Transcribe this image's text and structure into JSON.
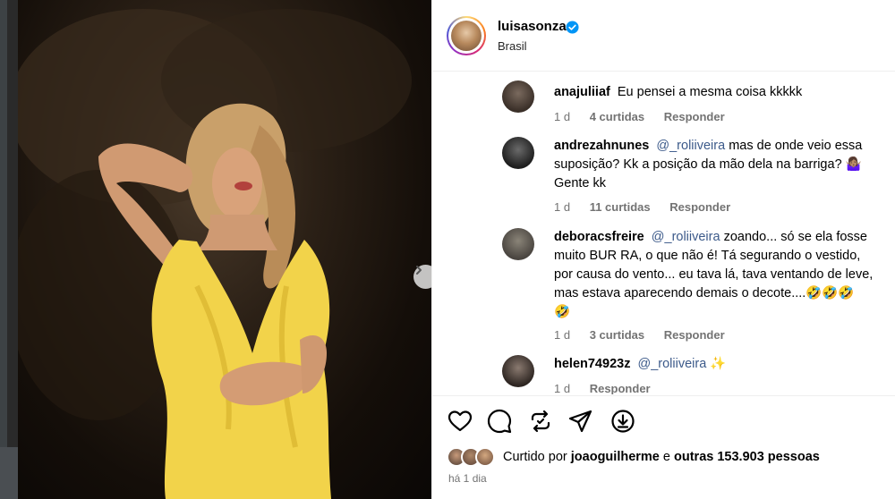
{
  "post": {
    "username": "luisasonza",
    "location": "Brasil",
    "verified": true
  },
  "comments": [
    {
      "user": "anajuliiaf",
      "text": "Eu pensei a mesma coisa kkkkk",
      "time": "1 d",
      "likes": "4 curtidas",
      "reply": "Responder"
    },
    {
      "user": "andrezahnunes",
      "mention": "@_roliiveira",
      "text_lines": [
        "mas de onde veio essa",
        "suposição? Kk a posição da mão dela na barriga? 🤷🏽‍♀️",
        "Gente kk"
      ],
      "time": "1 d",
      "likes": "11 curtidas",
      "reply": "Responder"
    },
    {
      "user": "deboracsfreire",
      "mention": "@_roliiveira",
      "text_lines": [
        "zoando... só se ela fosse",
        "muito BUR RA, o que não é! Tá segurando o vestido,",
        "por causa do vento... eu tava lá, tava ventando de leve,",
        "mas estava aparecendo demais o decote....🤣🤣🤣",
        "🤣"
      ],
      "time": "1 d",
      "likes": "3 curtidas",
      "reply": "Responder"
    },
    {
      "user": "helen74923z",
      "mention": "@_roliiveira",
      "text": "✨",
      "time": "1 d",
      "reply": "Responder"
    }
  ],
  "likes": {
    "prefix": "Curtido por",
    "user": "joaoguilherme",
    "middle": "e",
    "others": "outras 153.903 pessoas"
  },
  "date": "há 1 dia",
  "icons": {
    "like": "heart-icon",
    "comment": "comment-icon",
    "share": "repost-icon",
    "send": "send-icon",
    "save": "download-icon",
    "next": "chevron-right-icon"
  },
  "colors": {
    "dress": "#f2d34a",
    "mention": "#3c5a8a",
    "verified": "#0095f6",
    "muted": "#737373"
  }
}
